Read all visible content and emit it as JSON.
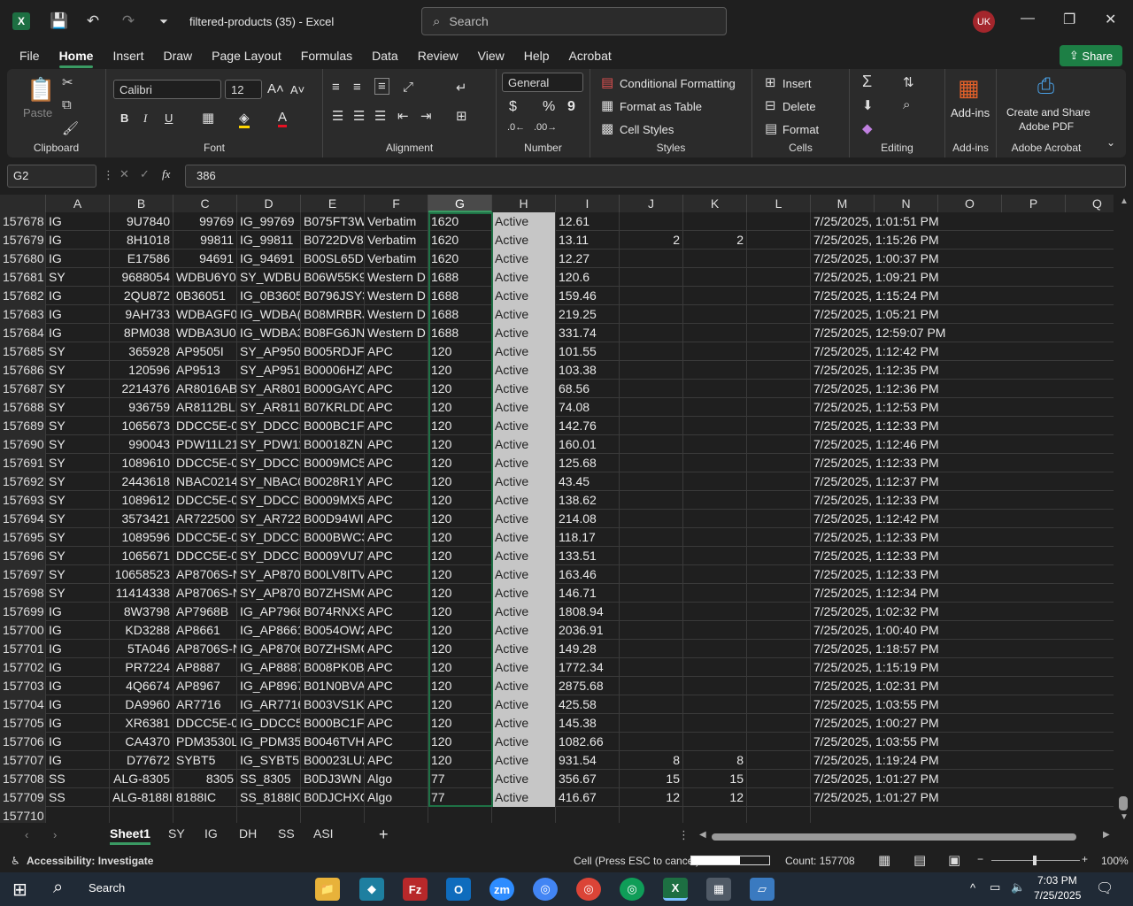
{
  "titlebar": {
    "app_icon": "X",
    "title": "filtered-products (35)  -  Excel",
    "search_placeholder": "Search",
    "avatar": "UK",
    "minimize": "—",
    "restore": "❐",
    "close": "✕"
  },
  "menu": [
    "File",
    "Home",
    "Insert",
    "Draw",
    "Page Layout",
    "Formulas",
    "Data",
    "Review",
    "View",
    "Help",
    "Acrobat"
  ],
  "active_menu": "Home",
  "share_label": "Share",
  "ribbon": {
    "clipboard": {
      "label": "Clipboard",
      "paste": "Paste"
    },
    "font": {
      "label": "Font",
      "name": "Calibri",
      "size": "12",
      "bold": "B",
      "italic": "I",
      "underline": "U"
    },
    "alignment": {
      "label": "Alignment"
    },
    "number": {
      "label": "Number",
      "format": "General",
      "currency": "$",
      "percent": "%",
      "comma": "9"
    },
    "styles": {
      "label": "Styles",
      "cond_format": "Conditional Formatting",
      "format_table": "Format as Table",
      "cell_styles": "Cell Styles"
    },
    "cells": {
      "label": "Cells",
      "insert": "Insert",
      "delete": "Delete",
      "format": "Format"
    },
    "editing": {
      "label": "Editing"
    },
    "addins": {
      "label": "Add-ins",
      "btn": "Add-ins"
    },
    "acrobat": {
      "label": "Adobe Acrobat",
      "btn1": "Create and Share",
      "btn2": "Adobe PDF"
    }
  },
  "formula": {
    "namebox": "G2",
    "value": "386",
    "fx": "fx"
  },
  "columns": [
    "A",
    "B",
    "C",
    "D",
    "E",
    "F",
    "G",
    "H",
    "I",
    "J",
    "K",
    "L",
    "M",
    "N",
    "O",
    "P",
    "Q"
  ],
  "rows": [
    [
      "157678",
      "IG",
      "9U7840",
      "99769",
      "IG_99769",
      "B075FT3W",
      "Verbatim",
      "1620",
      "Active",
      "12.61",
      "",
      "",
      "",
      "7/25/2025, 1:01:51 PM"
    ],
    [
      "157679",
      "IG",
      "8H1018",
      "99811",
      "IG_99811",
      "B0722DV8",
      "Verbatim",
      "1620",
      "Active",
      "13.11",
      "2",
      "2",
      "",
      "7/25/2025, 1:15:26 PM"
    ],
    [
      "157680",
      "IG",
      "E17586",
      "94691",
      "IG_94691",
      "B00SL65D)",
      "Verbatim",
      "1620",
      "Active",
      "12.27",
      "",
      "",
      "",
      "7/25/2025, 1:00:37 PM"
    ],
    [
      "157681",
      "SY",
      "9688054",
      "WDBU6Y0(",
      "SY_WDBU(",
      "B06W55K9",
      "Western D",
      "1688",
      "Active",
      "120.6",
      "",
      "",
      "",
      "7/25/2025, 1:09:21 PM"
    ],
    [
      "157682",
      "IG",
      "2QU872",
      "0B36051",
      "IG_0B3605",
      "B0796JSY3",
      "Western D",
      "1688",
      "Active",
      "159.46",
      "",
      "",
      "",
      "7/25/2025, 1:15:24 PM"
    ],
    [
      "157683",
      "IG",
      "9AH733",
      "WDBAGF0(",
      "IG_WDBA(",
      "B08MRBRJ",
      "Western D",
      "1688",
      "Active",
      "219.25",
      "",
      "",
      "",
      "7/25/2025, 1:05:21 PM"
    ],
    [
      "157684",
      "IG",
      "8PM038",
      "WDBA3U0(",
      "IG_WDBA3",
      "B08FG6JNZ",
      "Western D",
      "1688",
      "Active",
      "331.74",
      "",
      "",
      "",
      "7/25/2025, 12:59:07 PM"
    ],
    [
      "157685",
      "SY",
      "365928",
      "AP9505I",
      "SY_AP9505",
      "B005RDJFI",
      "APC",
      "120",
      "Active",
      "101.55",
      "",
      "",
      "",
      "7/25/2025, 1:12:42 PM"
    ],
    [
      "157686",
      "SY",
      "120596",
      "AP9513",
      "SY_AP9513",
      "B00006HZ\\",
      "APC",
      "120",
      "Active",
      "103.38",
      "",
      "",
      "",
      "7/25/2025, 1:12:35 PM"
    ],
    [
      "157687",
      "SY",
      "2214376",
      "AR8016AB",
      "SY_AR801(",
      "B000GAYC",
      "APC",
      "120",
      "Active",
      "68.56",
      "",
      "",
      "",
      "7/25/2025, 1:12:36 PM"
    ],
    [
      "157688",
      "SY",
      "936759",
      "AR8112BLI",
      "SY_AR8112",
      "B07KRLDD",
      "APC",
      "120",
      "Active",
      "74.08",
      "",
      "",
      "",
      "7/25/2025, 1:12:53 PM"
    ],
    [
      "157689",
      "SY",
      "1065673",
      "DDCC5E-0:",
      "SY_DDCC5",
      "B000BC1F/",
      "APC",
      "120",
      "Active",
      "142.76",
      "",
      "",
      "",
      "7/25/2025, 1:12:33 PM"
    ],
    [
      "157690",
      "SY",
      "990043",
      "PDW11L21",
      "SY_PDW11",
      "B00018ZN",
      "APC",
      "120",
      "Active",
      "160.01",
      "",
      "",
      "",
      "7/25/2025, 1:12:46 PM"
    ],
    [
      "157691",
      "SY",
      "1089610",
      "DDCC5E-0",
      "SY_DDCC5",
      "B0009MC5",
      "APC",
      "120",
      "Active",
      "125.68",
      "",
      "",
      "",
      "7/25/2025, 1:12:33 PM"
    ],
    [
      "157692",
      "SY",
      "2443618",
      "NBAC0214",
      "SY_NBAC0",
      "B0028R1YS",
      "APC",
      "120",
      "Active",
      "43.45",
      "",
      "",
      "",
      "7/25/2025, 1:12:37 PM"
    ],
    [
      "157693",
      "SY",
      "1089612",
      "DDCC5E-0",
      "SY_DDCC5",
      "B0009MX5",
      "APC",
      "120",
      "Active",
      "138.62",
      "",
      "",
      "",
      "7/25/2025, 1:12:33 PM"
    ],
    [
      "157694",
      "SY",
      "3573421",
      "AR722500",
      "SY_AR7225",
      "B00D94WI",
      "APC",
      "120",
      "Active",
      "214.08",
      "",
      "",
      "",
      "7/25/2025, 1:12:42 PM"
    ],
    [
      "157695",
      "SY",
      "1089596",
      "DDCC5E-0:",
      "SY_DDCC5",
      "B000BWC3",
      "APC",
      "120",
      "Active",
      "118.17",
      "",
      "",
      "",
      "7/25/2025, 1:12:33 PM"
    ],
    [
      "157696",
      "SY",
      "1065671",
      "DDCC5E-0:",
      "SY_DDCC5",
      "B0009VU7",
      "APC",
      "120",
      "Active",
      "133.51",
      "",
      "",
      "",
      "7/25/2025, 1:12:33 PM"
    ],
    [
      "157697",
      "SY",
      "10658523",
      "AP8706S-N",
      "SY_AP8706",
      "B00LV8ITV",
      "APC",
      "120",
      "Active",
      "163.46",
      "",
      "",
      "",
      "7/25/2025, 1:12:33 PM"
    ],
    [
      "157698",
      "SY",
      "11414338",
      "AP8706S-N",
      "SY_AP8706",
      "B07ZHSMC",
      "APC",
      "120",
      "Active",
      "146.71",
      "",
      "",
      "",
      "7/25/2025, 1:12:34 PM"
    ],
    [
      "157699",
      "IG",
      "8W3798",
      "AP7968B",
      "IG_AP7968",
      "B074RNXSI",
      "APC",
      "120",
      "Active",
      "1808.94",
      "",
      "",
      "",
      "7/25/2025, 1:02:32 PM"
    ],
    [
      "157700",
      "IG",
      "KD3288",
      "AP8661",
      "IG_AP8661",
      "B0054OW2",
      "APC",
      "120",
      "Active",
      "2036.91",
      "",
      "",
      "",
      "7/25/2025, 1:00:40 PM"
    ],
    [
      "157701",
      "IG",
      "5TA046",
      "AP8706S-N",
      "IG_AP8706",
      "B07ZHSMC",
      "APC",
      "120",
      "Active",
      "149.28",
      "",
      "",
      "",
      "7/25/2025, 1:18:57 PM"
    ],
    [
      "157702",
      "IG",
      "PR7224",
      "AP8887",
      "IG_AP8887",
      "B008PK0B7",
      "APC",
      "120",
      "Active",
      "1772.34",
      "",
      "",
      "",
      "7/25/2025, 1:15:19 PM"
    ],
    [
      "157703",
      "IG",
      "4Q6674",
      "AP8967",
      "IG_AP8967",
      "B01N0BVA",
      "APC",
      "120",
      "Active",
      "2875.68",
      "",
      "",
      "",
      "7/25/2025, 1:02:31 PM"
    ],
    [
      "157704",
      "IG",
      "DA9960",
      "AR7716",
      "IG_AR7716",
      "B003VS1KI",
      "APC",
      "120",
      "Active",
      "425.58",
      "",
      "",
      "",
      "7/25/2025, 1:03:55 PM"
    ],
    [
      "157705",
      "IG",
      "XR6381",
      "DDCC5E-0:",
      "IG_DDCC5",
      "B000BC1F/",
      "APC",
      "120",
      "Active",
      "145.38",
      "",
      "",
      "",
      "7/25/2025, 1:00:27 PM"
    ],
    [
      "157706",
      "IG",
      "CA4370",
      "PDM3530L",
      "IG_PDM35",
      "B0046TVH",
      "APC",
      "120",
      "Active",
      "1082.66",
      "",
      "",
      "",
      "7/25/2025, 1:03:55 PM"
    ],
    [
      "157707",
      "IG",
      "D77672",
      "SYBT5",
      "IG_SYBT5",
      "B00023LU2",
      "APC",
      "120",
      "Active",
      "931.54",
      "8",
      "8",
      "",
      "7/25/2025, 1:19:24 PM"
    ],
    [
      "157708",
      "SS",
      "ALG-8305",
      "8305",
      "SS_8305",
      "B0DJ3WN",
      "Algo",
      "77",
      "Active",
      "356.67",
      "15",
      "15",
      "",
      "7/25/2025, 1:01:27 PM"
    ],
    [
      "157709",
      "SS",
      "ALG-8188I",
      "8188IC",
      "SS_8188IC",
      "B0DJCHXC",
      "Algo",
      "77",
      "Active",
      "416.67",
      "12",
      "12",
      "",
      "7/25/2025, 1:01:27 PM"
    ],
    [
      "157710",
      "",
      "",
      "",
      "",
      "",
      "",
      "",
      "",
      "",
      "",
      "",
      "",
      ""
    ]
  ],
  "sheets": [
    "Sheet1",
    "SY",
    "IG",
    "DH",
    "SS",
    "ASI"
  ],
  "active_sheet": "Sheet1",
  "status": {
    "accessibility": "Accessibility: Investigate",
    "mode": "Cell (Press ESC to cancel):",
    "count": "Count: 157708",
    "zoom": "100%"
  },
  "taskbar": {
    "search": "Search",
    "time": "7:03 PM",
    "date": "7/25/2025"
  }
}
